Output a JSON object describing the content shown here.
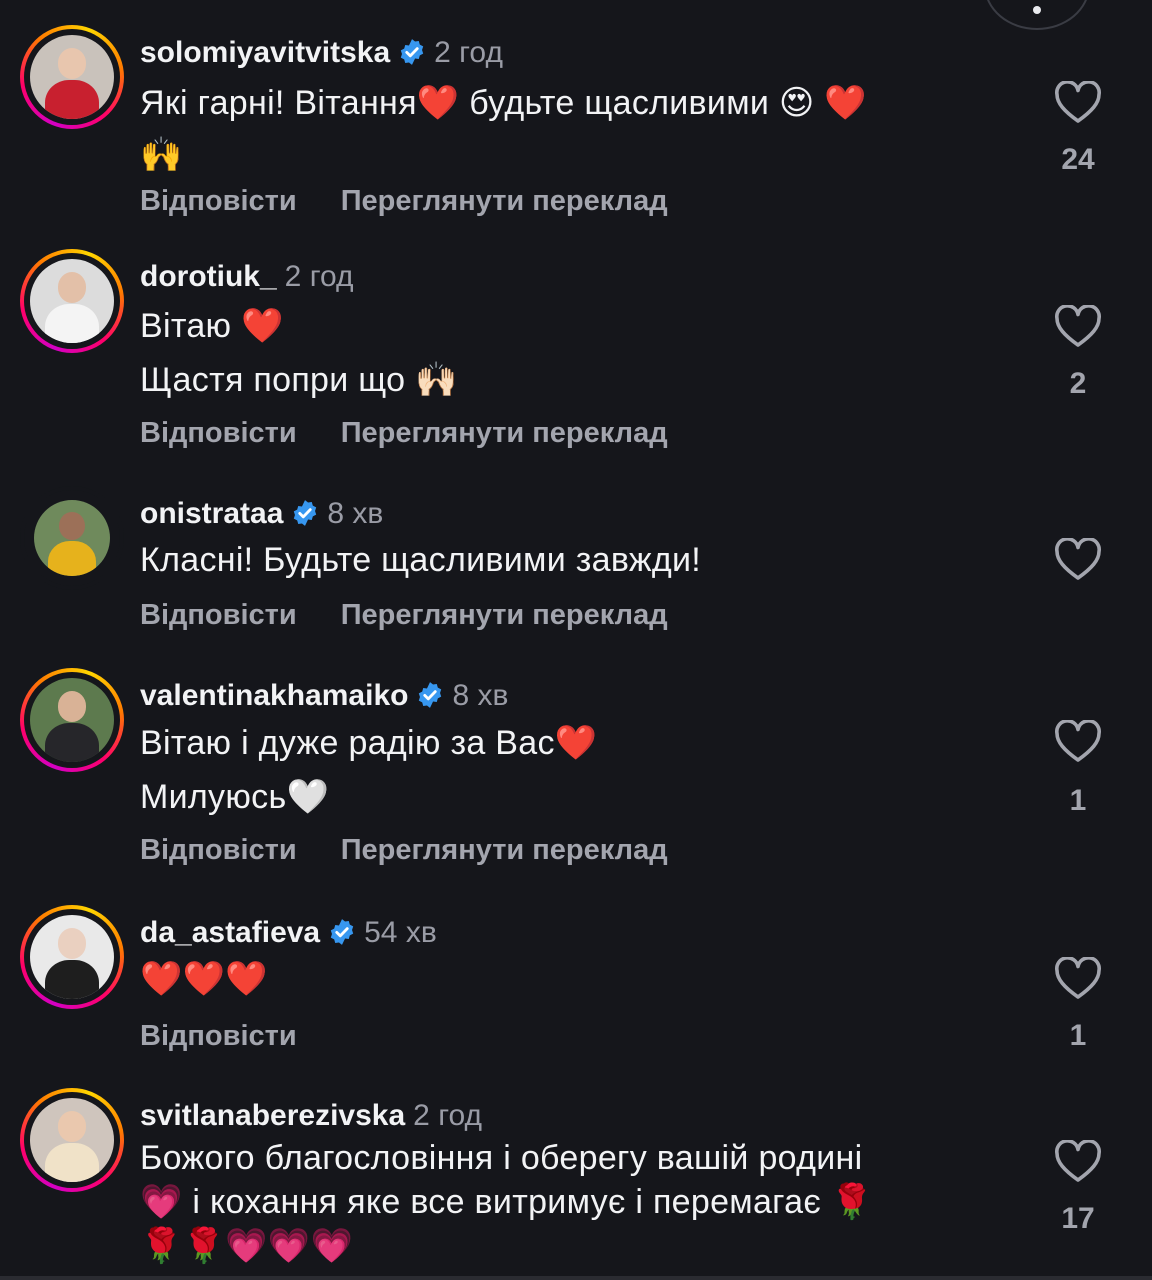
{
  "colors": {
    "background": "#15161b",
    "muted": "#a3a5ae",
    "verified": "#3797f0",
    "story_ring": [
      "#d300c5",
      "#ff0069",
      "#ff7a00",
      "#ffd600"
    ]
  },
  "icons": {
    "like": "heart-outline-icon",
    "verified": "verified-badge-icon"
  },
  "comments": [
    {
      "username": "solomiyavitvitska",
      "verified": true,
      "time": "2 год",
      "text": "Які гарні! Вітання❤️  будьте щасливими 😍 ❤️\n🙌",
      "reply_label": "Відповісти",
      "translate_label": "Переглянути переклад",
      "likes": "24"
    },
    {
      "username": "dorotiuk_",
      "verified": false,
      "time": "2 год",
      "text": "Вітаю ❤️\nЩастя попри що 🙌🏻",
      "reply_label": "Відповісти",
      "translate_label": "Переглянути переклад",
      "likes": "2"
    },
    {
      "username": "onistrataa",
      "verified": true,
      "time": "8 хв",
      "text": "Класні! Будьте щасливими завжди!",
      "reply_label": "Відповісти",
      "translate_label": "Переглянути переклад",
      "likes": ""
    },
    {
      "username": "valentinakhamaiko",
      "verified": true,
      "time": "8 хв",
      "text": "Вітаю і дуже радію за Вас❤️\nМилуюсь🤍",
      "reply_label": "Відповісти",
      "translate_label": "Переглянути переклад",
      "likes": "1"
    },
    {
      "username": "da_astafieva",
      "verified": true,
      "time": "54 хв",
      "text": "❤️❤️❤️",
      "reply_label": "Відповісти",
      "likes": "1"
    },
    {
      "username": "svitlanaberezivska",
      "verified": false,
      "time": "2 год",
      "text": "Божого благословіння і оберегу вашій родині\n💗 і кохання яке все витримує і перемагає 🌹\n🌹🌹💗💗💗",
      "likes": "17"
    }
  ]
}
